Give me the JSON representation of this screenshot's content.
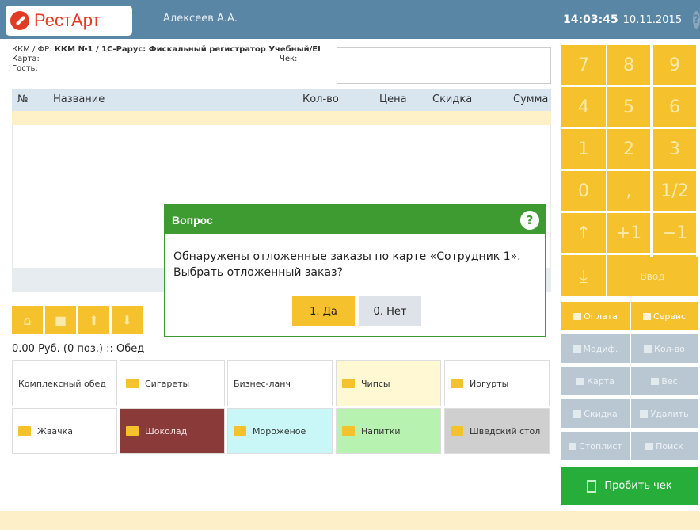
{
  "header": {
    "logo": "РестАрт",
    "user": "Алексеев А.А.",
    "time": "14:03:45",
    "date": "10.11.2015",
    "help": "?"
  },
  "info": {
    "kkm_prefix": "ККМ / ФР: ",
    "kkm_value": "ККМ №1 / 1С-Рарус: Фискальный регистратор Учебный/ЕI",
    "card_label": "Карта:",
    "check_label": "Чек:",
    "guest_label": "Гость:"
  },
  "table": {
    "columns": [
      "№",
      "Название",
      "Кол-во",
      "Цена",
      "Скидка",
      "Сумма"
    ]
  },
  "nav_icons": [
    "home-icon",
    "folder-icon",
    "arrow-up-icon",
    "arrow-down-icon"
  ],
  "status": "0.00 Руб. (0 поз.) :: Обед",
  "categories": [
    {
      "label": "Комплексный обед",
      "folder": false,
      "bg": "#ffffff"
    },
    {
      "label": "Сигареты",
      "folder": true,
      "bg": "#ffffff"
    },
    {
      "label": "Бизнес-ланч",
      "folder": false,
      "bg": "#ffffff"
    },
    {
      "label": "Чипсы",
      "folder": true,
      "bg": "#fff8d2"
    },
    {
      "label": "Йогурты",
      "folder": true,
      "bg": "#ffffff"
    },
    {
      "label": "Жвачка",
      "folder": true,
      "bg": "#ffffff"
    },
    {
      "label": "Шоколад",
      "folder": true,
      "bg": "#8b3a3a"
    },
    {
      "label": "Мороженое",
      "folder": true,
      "bg": "#c9f6f6"
    },
    {
      "label": "Напитки",
      "folder": true,
      "bg": "#b7f2b0"
    },
    {
      "label": "Шведский стол",
      "folder": true,
      "bg": "#cfcfcf"
    }
  ],
  "keypad": [
    "7",
    "8",
    "9",
    "4",
    "5",
    "6",
    "1",
    "2",
    "3",
    "0",
    ",",
    "1/2",
    "↑",
    "+1",
    "−1",
    "↓",
    "⌫",
    "×"
  ],
  "enter_label": "Ввод",
  "actions": [
    {
      "label": "Оплата",
      "icon": "wallet-icon",
      "style": "yellow"
    },
    {
      "label": "Сервис",
      "icon": "bell-icon",
      "style": "yellow"
    },
    {
      "label": "Модиф.",
      "icon": "modifier-icon",
      "style": "grey"
    },
    {
      "label": "Кол-во",
      "icon": "quantity-icon",
      "style": "grey"
    },
    {
      "label": "Карта",
      "icon": "card-icon",
      "style": "grey"
    },
    {
      "label": "Вес",
      "icon": "weight-icon",
      "style": "grey"
    },
    {
      "label": "Скидка",
      "icon": "discount-icon",
      "style": "grey"
    },
    {
      "label": "Удалить",
      "icon": "trash-icon",
      "style": "grey"
    },
    {
      "label": "Стоплист",
      "icon": "stop-icon",
      "style": "grey"
    },
    {
      "label": "Поиск",
      "icon": "search-icon",
      "style": "grey"
    }
  ],
  "pay_button": "Пробить чек",
  "dialog": {
    "title": "Вопрос",
    "help": "?",
    "line1": "Обнаружены отложенные заказы по карте «Сотрудник 1».",
    "line2": "Выбрать отложенный заказ?",
    "yes": "1. Да",
    "no": "0. Нет"
  },
  "colors": {
    "accent": "#f5c22d",
    "header": "#5a86a6",
    "dialog": "#3d9b32",
    "pay": "#27ae3a"
  }
}
